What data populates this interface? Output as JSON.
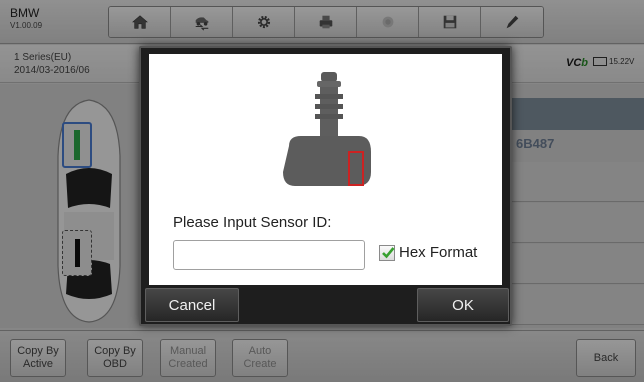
{
  "app": {
    "brand": "BMW",
    "version": "V1.00.09"
  },
  "toolbar": {
    "items": [
      "home-icon",
      "vehicle-swap-icon",
      "settings-icon",
      "print-icon",
      "help-icon",
      "save-icon",
      "pen-icon"
    ]
  },
  "vehicle": {
    "series": "1 Series(EU)",
    "years": "2014/03-2016/06"
  },
  "status": {
    "vci_prefix": "VC",
    "vci_suffix": "b",
    "battery": "15.22V"
  },
  "background": {
    "sensor_id_partial": "6B487"
  },
  "dialog": {
    "prompt": "Please Input Sensor ID:",
    "input_value": "",
    "input_placeholder": "",
    "hex_label": "Hex Format",
    "hex_checked": true,
    "cancel_label": "Cancel",
    "ok_label": "OK",
    "sensor_highlight_color": "#cc2222"
  },
  "bottom": {
    "copy_active": "Copy By\nActive",
    "copy_obd": "Copy By\nOBD",
    "manual_created": "Manual\nCreated",
    "auto_create": "Auto\nCreate",
    "back": "Back"
  }
}
